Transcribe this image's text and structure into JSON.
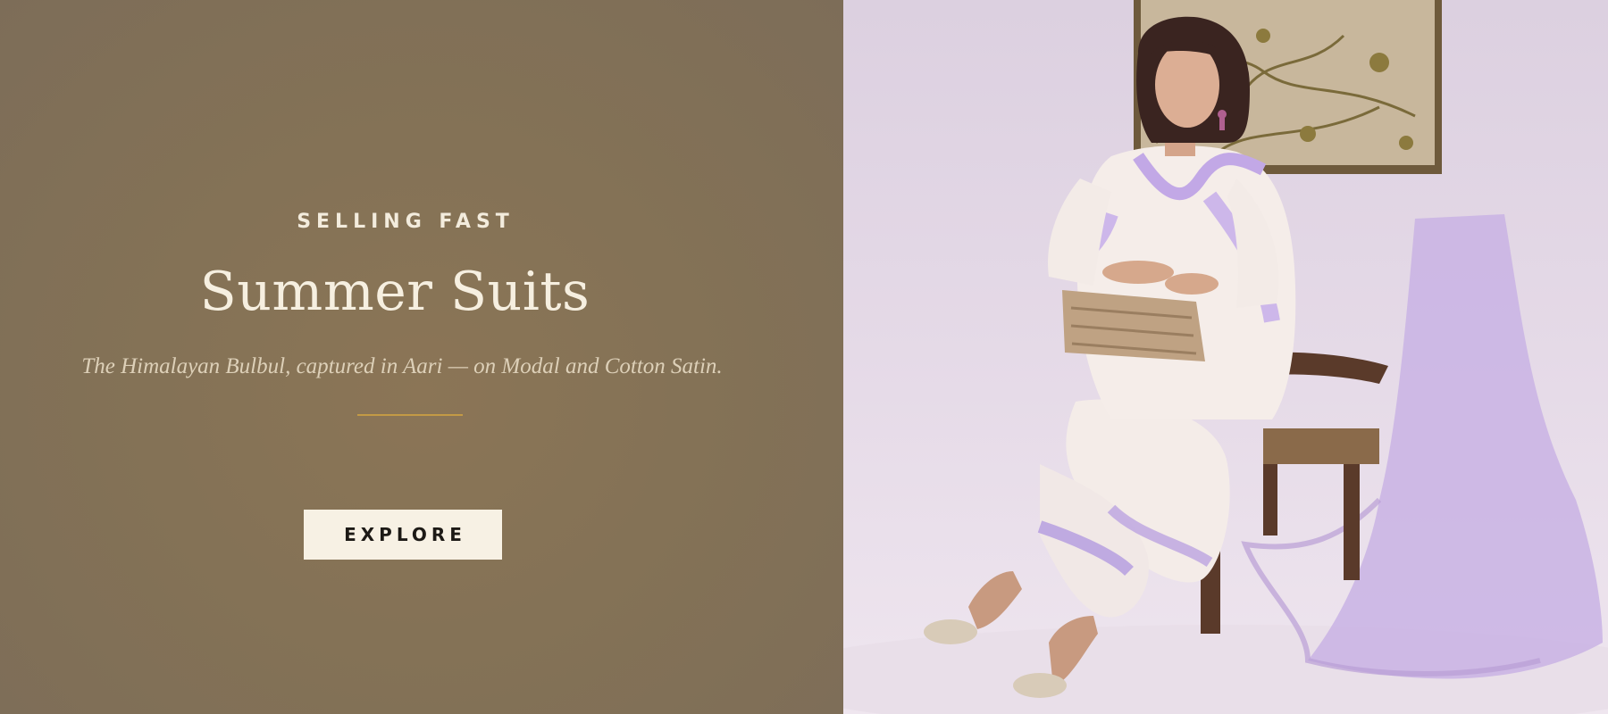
{
  "hero": {
    "eyebrow": "SELLING FAST",
    "title": "Summer Suits",
    "subtitle": "The Himalayan Bulbul, captured in Aari — on Modal and Cotton Satin.",
    "cta_label": "EXPLORE"
  },
  "colors": {
    "left_panel_bg": "#857256",
    "accent_divider": "#c39a45",
    "button_bg": "#f7f1e4",
    "button_text": "#1d1a16",
    "heading_text": "#f6efe0"
  },
  "image": {
    "icon": "model-photo-icon"
  }
}
